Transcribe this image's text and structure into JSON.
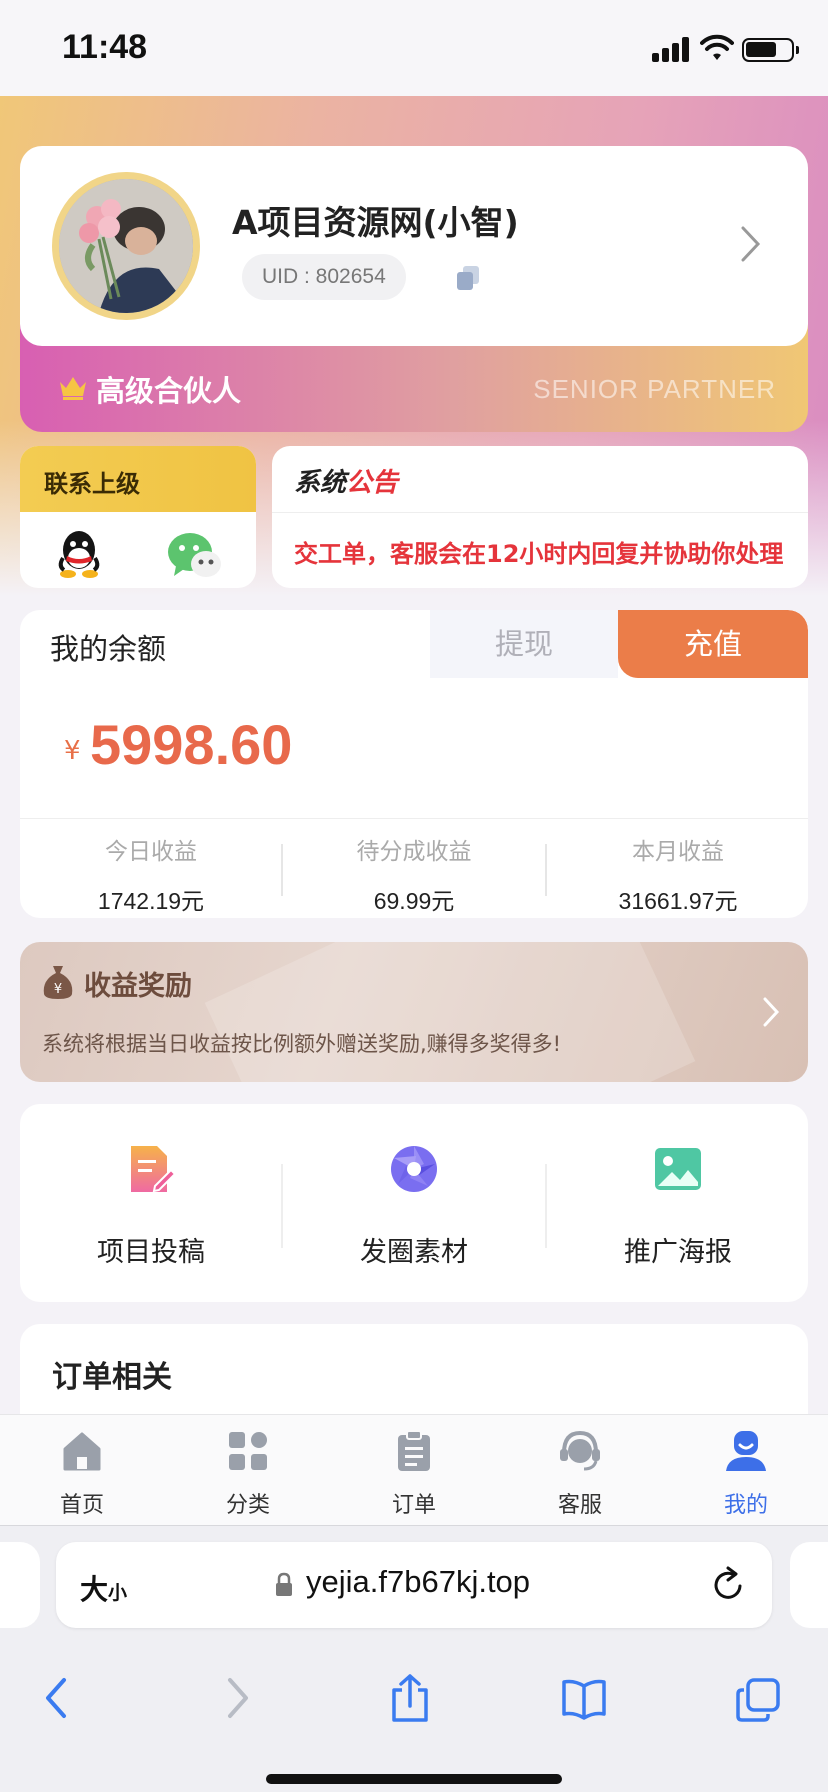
{
  "status_bar": {
    "time": "11:48"
  },
  "profile": {
    "name": "A项目资源网(小智)",
    "uid": "UID : 802654",
    "level_title": "高级合伙人",
    "level_en": "SENIOR PARTNER"
  },
  "contact": {
    "title": "联系上级"
  },
  "notice": {
    "title_a": "系统",
    "title_b": "公告",
    "text": "交工单，客服会在12小时内回复并协助你处理"
  },
  "balance": {
    "label": "我的余额",
    "withdraw": "提现",
    "recharge": "充值",
    "currency": "¥",
    "amount": "5998.60",
    "stats": [
      {
        "label": "今日收益",
        "value": "1742.19元"
      },
      {
        "label": "待分成收益",
        "value": "69.99元"
      },
      {
        "label": "本月收益",
        "value": "31661.97元"
      }
    ]
  },
  "reward": {
    "title": "收益奖励",
    "desc": "系统将根据当日收益按比例额外赠送奖励,赚得多奖得多!"
  },
  "tools": [
    {
      "label": "项目投稿",
      "icon": "document-edit-icon"
    },
    {
      "label": "发圈素材",
      "icon": "aperture-icon"
    },
    {
      "label": "推广海报",
      "icon": "image-icon"
    }
  ],
  "orders": {
    "title": "订单相关"
  },
  "tabs": [
    {
      "label": "首页",
      "icon": "home-icon"
    },
    {
      "label": "分类",
      "icon": "grid-icon"
    },
    {
      "label": "订单",
      "icon": "clipboard-icon"
    },
    {
      "label": "客服",
      "icon": "headset-icon"
    },
    {
      "label": "我的",
      "icon": "user-icon",
      "active": true
    }
  ],
  "browser": {
    "text_size_big": "大",
    "text_size_small": "小",
    "url": "yejia.f7b67kj.top"
  },
  "colors": {
    "accent_orange": "#eb7d49",
    "amount_red": "#e8694b",
    "notice_red": "#e5343b",
    "tab_active": "#3d6fe8"
  }
}
